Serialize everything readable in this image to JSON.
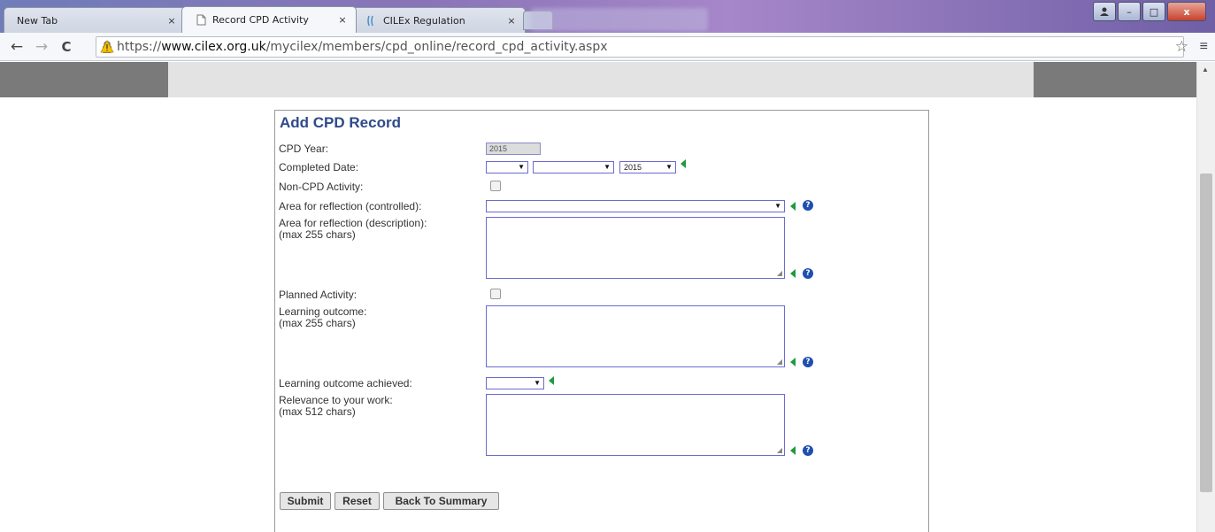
{
  "browser": {
    "tabs": [
      {
        "label": "New Tab",
        "close": "×"
      },
      {
        "label": "Record CPD Activity",
        "close": "×"
      },
      {
        "label": "CILEx Regulation",
        "close": "×"
      }
    ],
    "url": {
      "scheme": "https://",
      "host": "www.cilex.org.uk",
      "path": "/mycilex/members/cpd_online/record_cpd_activity.aspx"
    },
    "nav": {
      "back": "←",
      "forward": "→",
      "reload": "C"
    },
    "star": "☆",
    "menu": "≡",
    "window_buttons": {
      "minimize": "–",
      "maximize": "□",
      "close": "x"
    }
  },
  "form": {
    "title": "Add CPD Record",
    "fields": {
      "cpd_year": {
        "label": "CPD Year:",
        "value": "2015"
      },
      "completed_date": {
        "label": "Completed Date:",
        "year_value": "2015"
      },
      "non_cpd": {
        "label": "Non-CPD Activity:"
      },
      "area_controlled": {
        "label": "Area for reflection (controlled):"
      },
      "area_description": {
        "label": "Area for reflection (description):",
        "note": "(max 255 chars)"
      },
      "planned": {
        "label": "Planned Activity:"
      },
      "learning_outcome": {
        "label": "Learning outcome:",
        "note": "(max 255 chars)"
      },
      "outcome_achieved": {
        "label": "Learning outcome achieved:"
      },
      "relevance": {
        "label": "Relevance to your work:",
        "note": "(max 512 chars)"
      }
    },
    "buttons": {
      "submit": "Submit",
      "reset": "Reset",
      "back": "Back To Summary"
    },
    "help_glyph": "?"
  },
  "colors": {
    "title": "#2e4a8a",
    "required_marker": "#1f9a3c",
    "help": "#1e4fb0",
    "input_border": "#6b6bd0"
  }
}
